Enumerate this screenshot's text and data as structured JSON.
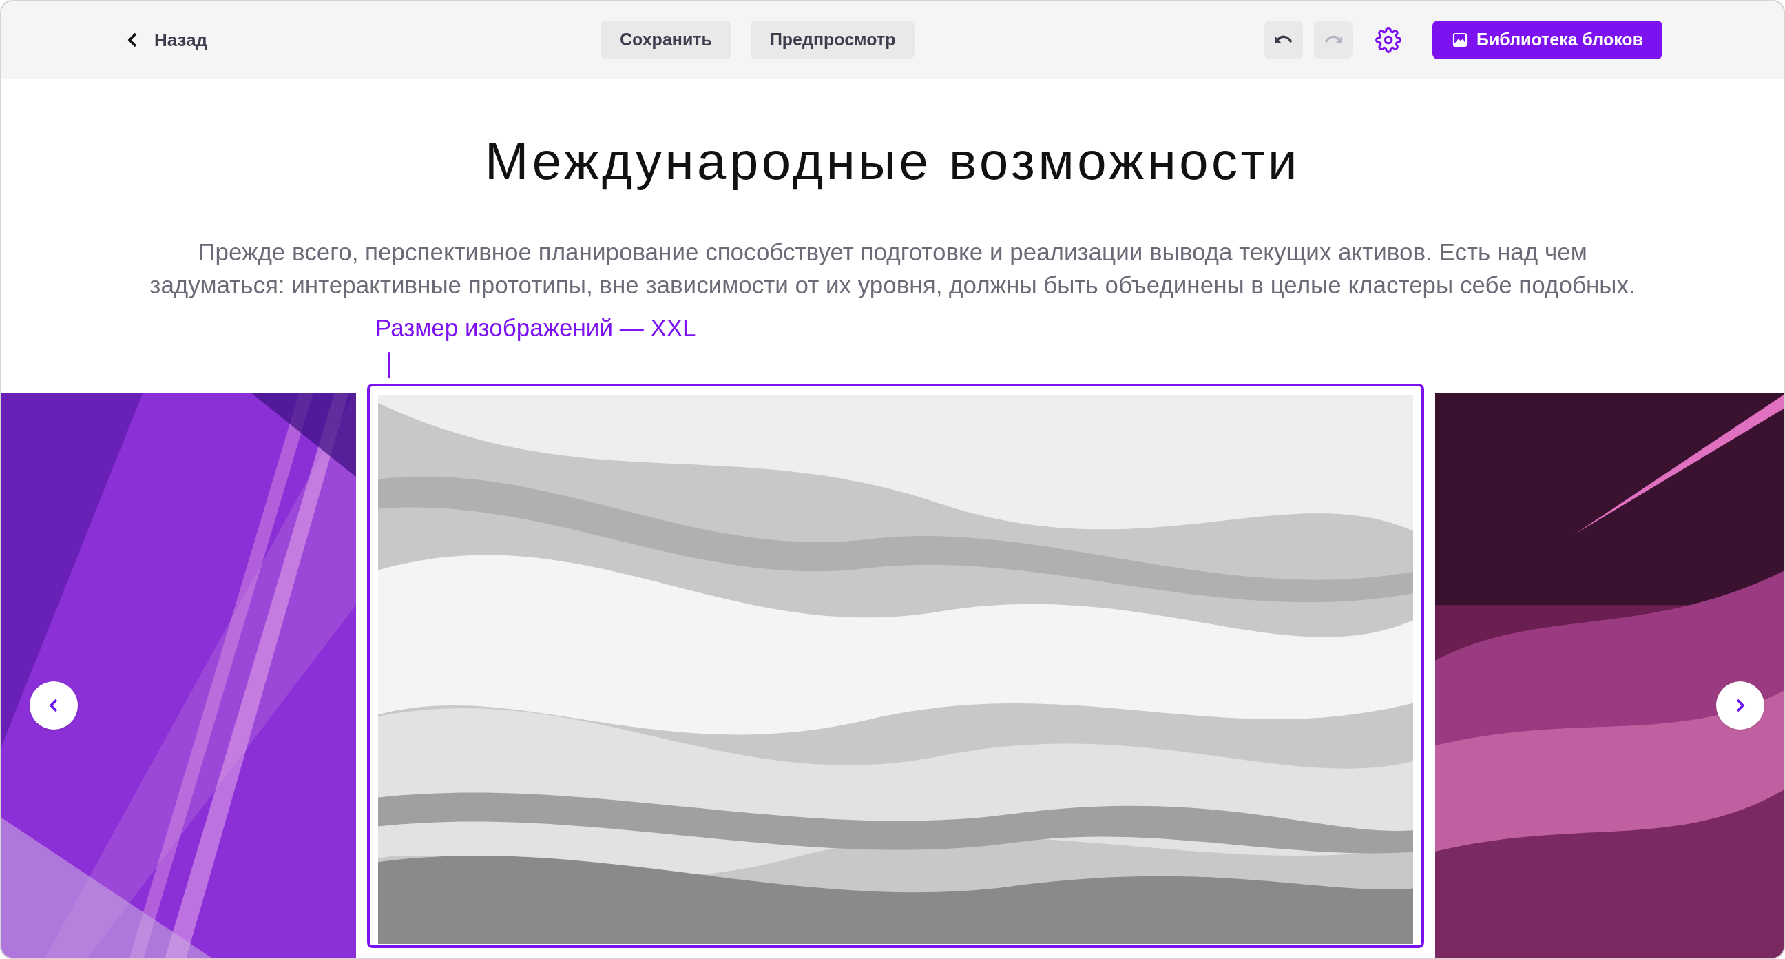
{
  "toolbar": {
    "back": "Назад",
    "buttons": [
      {
        "label": "Сохранить"
      },
      {
        "label": "Предпросмотр"
      }
    ],
    "undo": {
      "disabled": false
    },
    "redo": {
      "disabled": true
    },
    "library_button": "Библиотека блоков"
  },
  "heading": "Международные возможности",
  "description": "Прежде всего, перспективное планирование способствует подготовке и реализации вывода текущих активов. Есть над чем задуматься: интерактивные прототипы, вне зависимости от их уровня, должны быть объединены в целые кластеры себе подобных.",
  "annotation": "Размер изображений — XXL",
  "carousel": {
    "slides": [
      {
        "kind": "picture",
        "selected": false,
        "color": "#8b2fd6"
      },
      {
        "kind": "picture",
        "selected": true,
        "color": "#c8c8c8"
      },
      {
        "kind": "picture",
        "selected": false,
        "color": "#6a1f50"
      }
    ]
  }
}
